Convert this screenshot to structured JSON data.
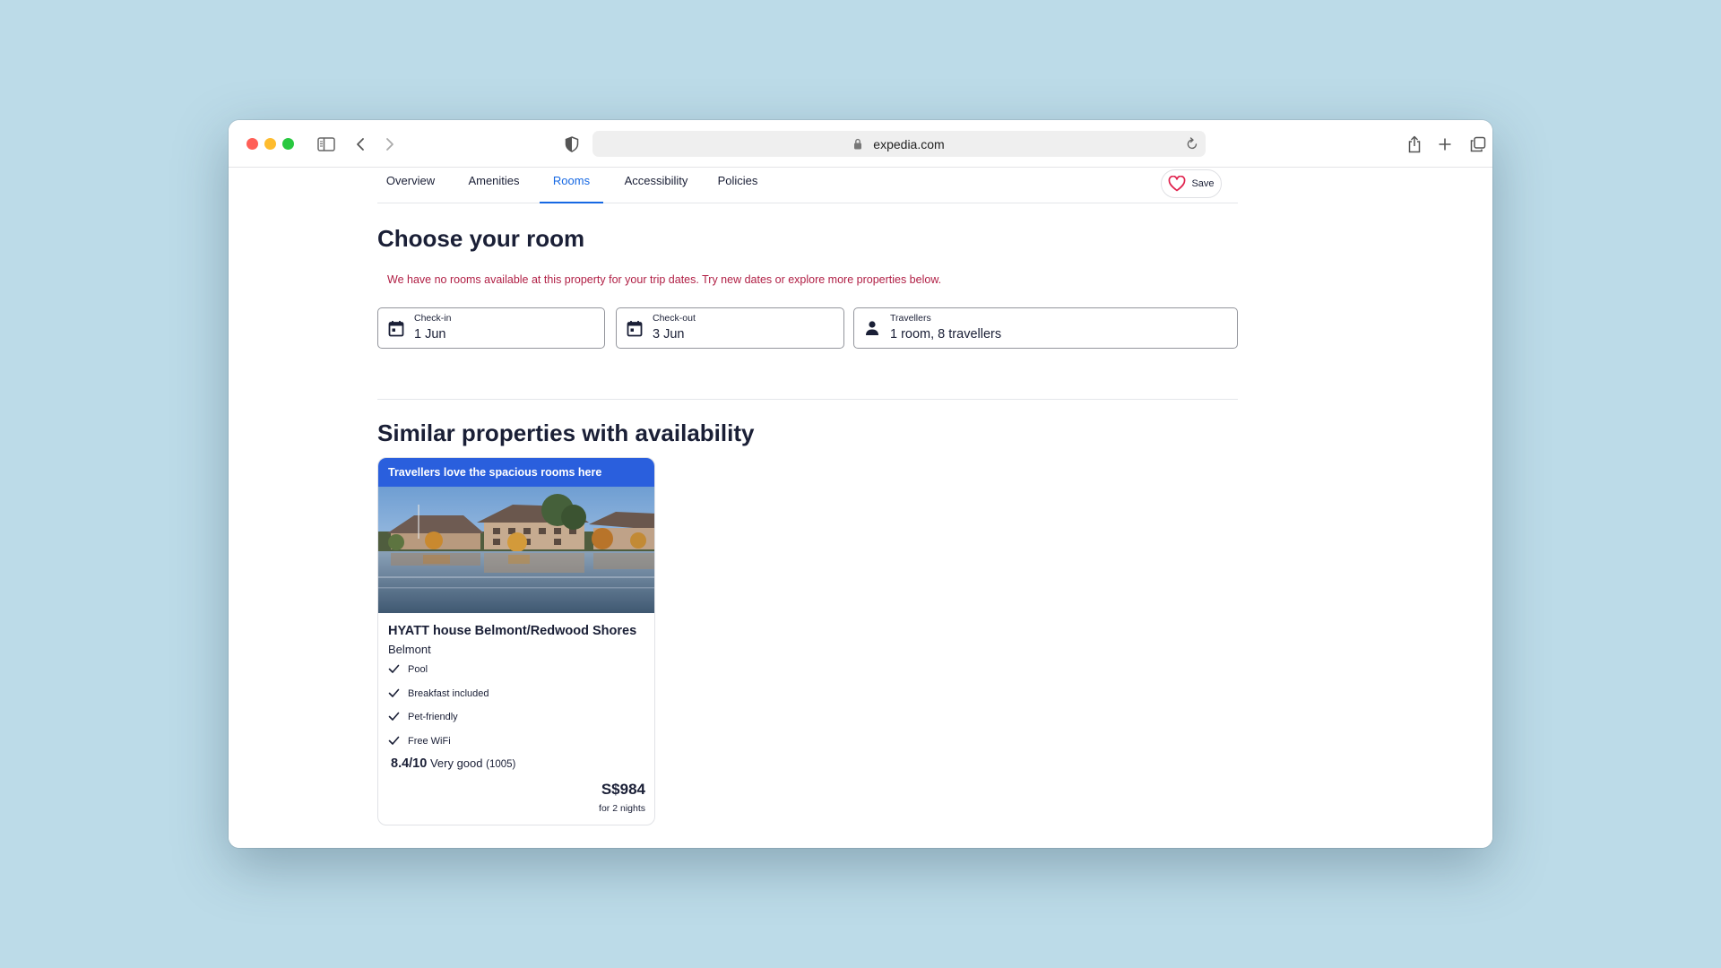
{
  "browser": {
    "url": "expedia.com"
  },
  "nav": {
    "tabs": [
      {
        "label": "Overview"
      },
      {
        "label": "Amenities"
      },
      {
        "label": "Rooms"
      },
      {
        "label": "Accessibility"
      },
      {
        "label": "Policies"
      }
    ],
    "active_tab": "Rooms",
    "save_label": "Save"
  },
  "rooms": {
    "title": "Choose your room",
    "alert": "We have no rooms available at this property for your trip dates. Try new dates or explore more properties below.",
    "checkin": {
      "label": "Check-in",
      "value": "1 Jun"
    },
    "checkout": {
      "label": "Check-out",
      "value": "3 Jun"
    },
    "travellers": {
      "label": "Travellers",
      "value": "1 room, 8 travellers"
    }
  },
  "similar": {
    "title": "Similar properties with availability",
    "card": {
      "banner": "Travellers love the spacious rooms here",
      "name": "HYATT house Belmont/Redwood Shores",
      "location": "Belmont",
      "amenities": [
        "Pool",
        "Breakfast included",
        "Pet-friendly",
        "Free WiFi"
      ],
      "rating_score": "8.4/10",
      "rating_text": "Very good",
      "rating_count": "(1005)",
      "price": "S$984",
      "price_note": "for 2 nights"
    }
  },
  "colors": {
    "accent": "#1668e3",
    "banner": "#2a5fdd",
    "alert": "#b01e44",
    "heart": "#e0234e",
    "desktop": "#bcdbe8"
  },
  "icons": {
    "sidebar": "sidebar-icon",
    "back": "chevron-left-icon",
    "forward": "chevron-right-icon",
    "shield": "shield-icon",
    "lock": "lock-icon",
    "reload": "reload-icon",
    "share": "share-icon",
    "new_tab": "plus-icon",
    "tabs": "tabs-overview-icon",
    "heart": "heart-icon",
    "calendar": "calendar-icon",
    "person": "person-icon",
    "check": "checkmark-icon"
  }
}
